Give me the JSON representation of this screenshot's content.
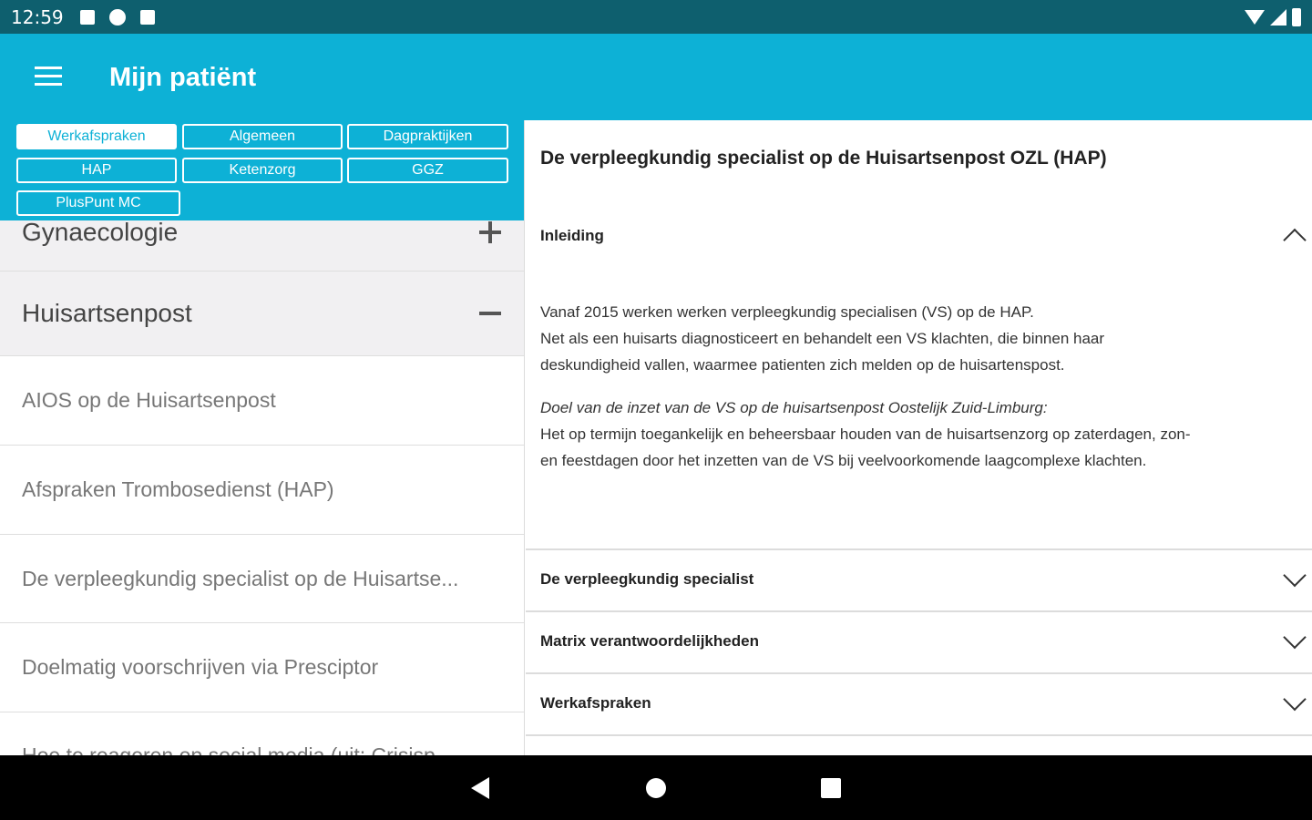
{
  "status_bar": {
    "time": "12:59",
    "icons": [
      "notification-icon",
      "flipboard-icon",
      "sd-card-icon"
    ],
    "right_icons": [
      "wifi-icon",
      "signal-icon",
      "battery-icon"
    ]
  },
  "app_bar": {
    "title": "Mijn patiënt",
    "menu_icon": "hamburger-menu-icon"
  },
  "filters": {
    "werkafspraken": "Werkafspraken",
    "algemeen": "Algemeen",
    "dagpraktijken": "Dagpraktijken",
    "hap": "HAP",
    "ketenzorg": "Ketenzorg",
    "ggz": "GGZ",
    "pluspunt": "PlusPunt MC",
    "active": "Werkafspraken"
  },
  "list": {
    "group_gynaecologie": "Gynaecologie",
    "group_huisartsenpost": "Huisartsenpost",
    "items": [
      "AIOS op de Huisartsenpost",
      "Afspraken Trombosedienst (HAP)",
      "De verpleegkundig specialist op de Huisartse...",
      "Doelmatig voorschrijven via Presciptor",
      "Hoe te reageren op social media (uit: Crisisp"
    ]
  },
  "detail": {
    "title": "De verpleegkundig specialist op de Huisartsenpost OZL (HAP)",
    "sections": [
      "Inleiding",
      "De verpleegkundig specialist",
      "Matrix verantwoordelijkheden",
      "Werkafspraken"
    ],
    "intro_p1_line1": "Vanaf 2015 werken werken verpleegkundig specialisen (VS) op de HAP.",
    "intro_p1_line2": "Net als een huisarts diagnosticeert en behandelt een VS klachten, die binnen haar",
    "intro_p1_line3": "deskundigheid vallen, waarmee patienten zich melden op de huisartenspost.",
    "intro_p2_italic": "Doel van de inzet van de VS op de huisartsenpost Oostelijk Zuid-Limburg:",
    "intro_p2_line1": "Het op termijn toegankelijk en beheersbaar houden van de huisartsenzorg op zaterdagen, zon-",
    "intro_p2_line2": "en feestdagen door het inzetten van de VS bij veelvoorkomende laagcomplexe klachten."
  },
  "nav_bar": {
    "icons": [
      "back-icon",
      "home-icon",
      "recents-icon"
    ]
  }
}
